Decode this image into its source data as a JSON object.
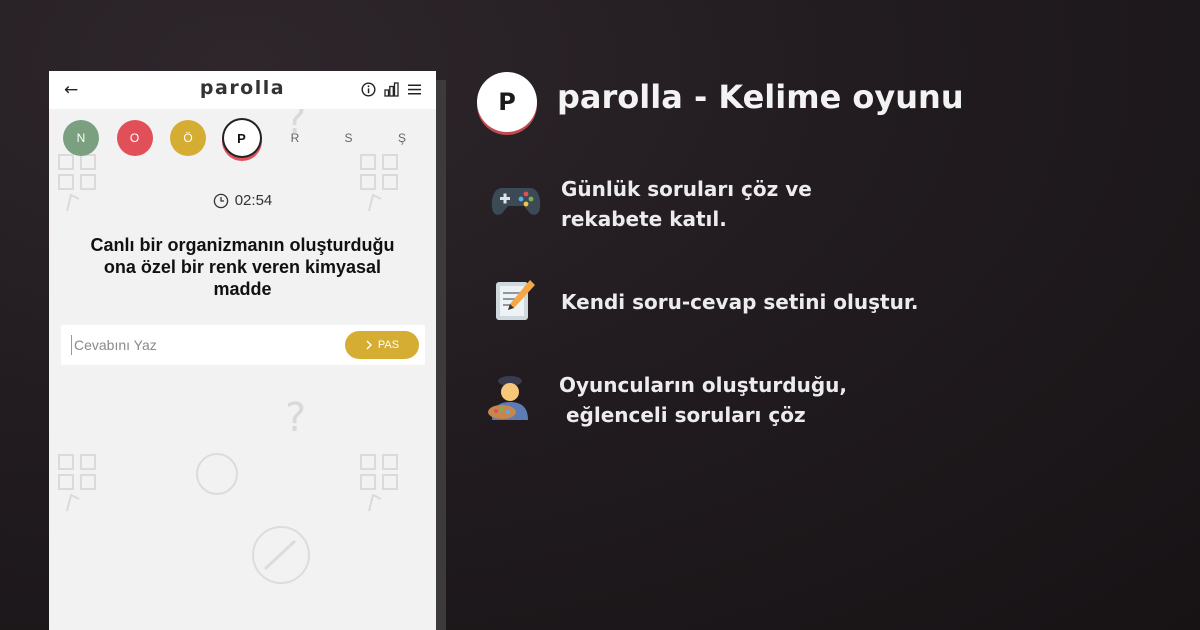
{
  "phone": {
    "title": "parolla",
    "letters": [
      {
        "char": "N",
        "state": "correct"
      },
      {
        "char": "O",
        "state": "wrong"
      },
      {
        "char": "Ö",
        "state": "passed"
      },
      {
        "char": "P",
        "state": "current"
      },
      {
        "char": "R",
        "state": "pending"
      },
      {
        "char": "S",
        "state": "pending"
      },
      {
        "char": "Ş",
        "state": "pending"
      }
    ],
    "timer": "02:54",
    "question": "Canlı bir organizmanın oluşturduğu ona özel bir renk veren kimyasal madde",
    "answer_placeholder": "Cevabını Yaz",
    "pas_label": "PAS"
  },
  "promo": {
    "logo_letter": "P",
    "headline": "parolla - Kelime oyunu",
    "features": [
      {
        "icon": "gamepad-icon",
        "text": "Günlük soruları çöz ve\nrekabete katıl."
      },
      {
        "icon": "memo-icon",
        "text": "Kendi soru-cevap setini oluştur."
      },
      {
        "icon": "artist-icon",
        "text": "Oyuncuların oluşturduğu,\n eğlenceli soruları çöz"
      }
    ]
  },
  "colors": {
    "correct": "#7aa07f",
    "wrong": "#e15058",
    "passed": "#d5ad32",
    "accent": "#c24a50"
  }
}
